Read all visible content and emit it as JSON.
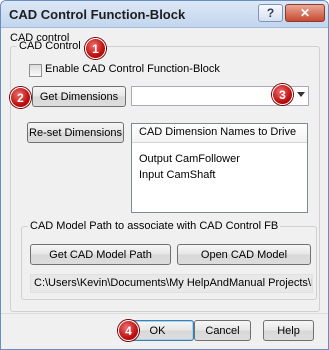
{
  "window": {
    "title": "CAD Control Function-Block",
    "help_glyph": "?",
    "close_glyph": "✕"
  },
  "tab_label": "CAD control",
  "cad_control": {
    "legend": "CAD Control",
    "enable_label": "Enable CAD Control Function-Block",
    "enable_checked": false,
    "get_dimensions_label": "Get Dimensions",
    "combo_value": "",
    "reset_dimensions_label": "Re-set Dimensions",
    "list_header": "CAD Dimension Names to Drive",
    "list_items": [
      "Output CamFollower",
      "Input CamShaft"
    ]
  },
  "model_path": {
    "legend": "CAD Model Path to associate with CAD Control FB",
    "get_path_label": "Get CAD Model Path",
    "open_model_label": "Open CAD Model",
    "path_value": "C:\\Users\\Kevin\\Documents\\My HelpAndManual Projects\\H"
  },
  "footer": {
    "ok_label": "OK",
    "cancel_label": "Cancel",
    "help_label": "Help"
  },
  "callouts": [
    "1",
    "2",
    "3",
    "4"
  ],
  "colors": {
    "callout": "#c01010",
    "titlebar": "#c3d6ee",
    "default_button_border": "#3c7fb1"
  }
}
